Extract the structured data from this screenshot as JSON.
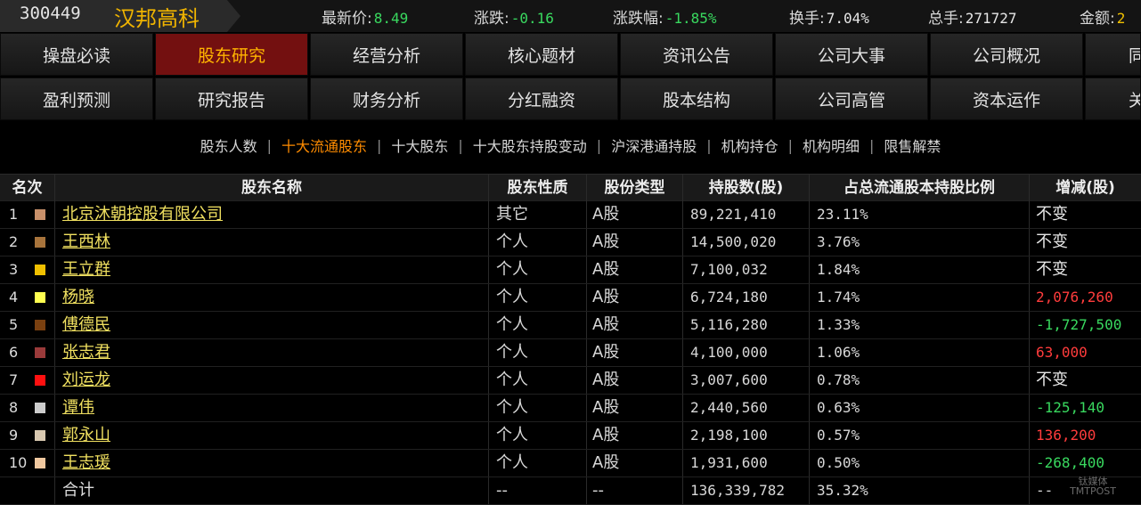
{
  "header": {
    "code": "300449",
    "name": "汉邦高科",
    "quotes": [
      {
        "label": "最新价:",
        "value": "8.49",
        "color": "green"
      },
      {
        "label": "涨跌:",
        "value": "-0.16",
        "color": "green"
      },
      {
        "label": "涨跌幅:",
        "value": "-1.85%",
        "color": "green"
      },
      {
        "label": "换手:",
        "value": "7.04%",
        "color": "white"
      },
      {
        "label": "总手:",
        "value": "271727",
        "color": "white"
      },
      {
        "label": "金额:",
        "value": "2",
        "color": "yellow"
      }
    ]
  },
  "nav": {
    "row1": [
      "操盘必读",
      "股东研究",
      "经营分析",
      "核心题材",
      "资讯公告",
      "公司大事",
      "公司概况",
      "同"
    ],
    "row2": [
      "盈利预测",
      "研究报告",
      "财务分析",
      "分红融资",
      "股本结构",
      "公司高管",
      "资本运作",
      "关"
    ],
    "active": "股东研究"
  },
  "subtabs": {
    "items": [
      "股东人数",
      "十大流通股东",
      "十大股东",
      "十大股东持股变动",
      "沪深港通持股",
      "机构持仓",
      "机构明细",
      "限售解禁"
    ],
    "active": "十大流通股东",
    "separator": "|"
  },
  "table": {
    "headers": {
      "rank": "名次",
      "name": "股东名称",
      "nature": "股东性质",
      "type": "股份类型",
      "shares": "持股数(股)",
      "pct": "占总流通股本持股比例",
      "change": "增减(股)"
    },
    "rows": [
      {
        "rank": "1",
        "swatch": "#c8906a",
        "name": "北京沐朝控股有限公司",
        "nature": "其它",
        "type": "A股",
        "shares": "89,221,410",
        "pct": "23.11%",
        "change": "不变",
        "change_color": "white"
      },
      {
        "rank": "2",
        "swatch": "#a8743c",
        "name": "王西林",
        "nature": "个人",
        "type": "A股",
        "shares": "14,500,020",
        "pct": "3.76%",
        "change": "不变",
        "change_color": "white"
      },
      {
        "rank": "3",
        "swatch": "#f0c000",
        "name": "王立群",
        "nature": "个人",
        "type": "A股",
        "shares": "7,100,032",
        "pct": "1.84%",
        "change": "不变",
        "change_color": "white"
      },
      {
        "rank": "4",
        "swatch": "#ffff50",
        "name": "杨晓",
        "nature": "个人",
        "type": "A股",
        "shares": "6,724,180",
        "pct": "1.74%",
        "change": "2,076,260",
        "change_color": "red"
      },
      {
        "rank": "5",
        "swatch": "#7a4010",
        "name": "傅德民",
        "nature": "个人",
        "type": "A股",
        "shares": "5,116,280",
        "pct": "1.33%",
        "change": "-1,727,500",
        "change_color": "green"
      },
      {
        "rank": "6",
        "swatch": "#9a3a3a",
        "name": "张志君",
        "nature": "个人",
        "type": "A股",
        "shares": "4,100,000",
        "pct": "1.06%",
        "change": "63,000",
        "change_color": "red"
      },
      {
        "rank": "7",
        "swatch": "#ff1010",
        "name": "刘运龙",
        "nature": "个人",
        "type": "A股",
        "shares": "3,007,600",
        "pct": "0.78%",
        "change": "不变",
        "change_color": "white"
      },
      {
        "rank": "8",
        "swatch": "#cccccc",
        "name": "谭伟",
        "nature": "个人",
        "type": "A股",
        "shares": "2,440,560",
        "pct": "0.63%",
        "change": "-125,140",
        "change_color": "green"
      },
      {
        "rank": "9",
        "swatch": "#d8c8b0",
        "name": "郭永山",
        "nature": "个人",
        "type": "A股",
        "shares": "2,198,100",
        "pct": "0.57%",
        "change": "136,200",
        "change_color": "red"
      },
      {
        "rank": "10",
        "swatch": "#f0c8a0",
        "name": "王志瑗",
        "nature": "个人",
        "type": "A股",
        "shares": "1,931,600",
        "pct": "0.50%",
        "change": "-268,400",
        "change_color": "green"
      }
    ],
    "total": {
      "label": "合计",
      "nature": "--",
      "type": "--",
      "shares": "136,339,782",
      "pct": "35.32%",
      "change": "--"
    }
  },
  "watermark": {
    "line1": "钛媒体",
    "line2": "TMTPOST"
  }
}
